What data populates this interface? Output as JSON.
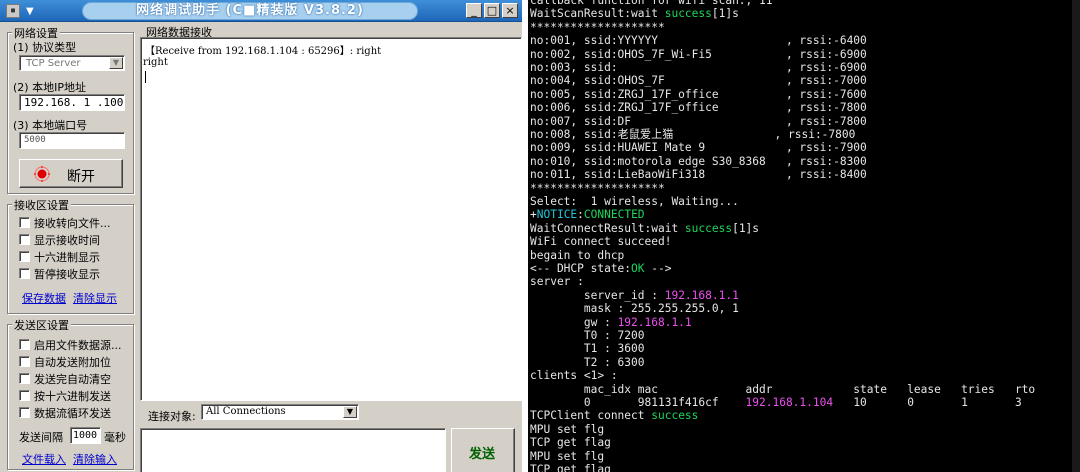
{
  "window": {
    "title": "网络调试助手 (C■精装版 V3.8.2)",
    "sys_icon": "▪",
    "sys_arrow": "▼",
    "controls": {
      "minimize": "_",
      "maximize": "□",
      "close": "×"
    }
  },
  "network_settings": {
    "title": "网络设置",
    "protocol_label": "(1) 协议类型",
    "protocol_value": "TCP Server",
    "ip_label": "(2) 本地IP地址",
    "ip_value": "192.168. 1 .100",
    "port_label": "(3) 本地端口号",
    "port_value": "5000",
    "disconnect_label": "断开"
  },
  "receive_settings": {
    "title": "接收区设置",
    "options": [
      "接收转向文件...",
      "显示接收时间",
      "十六进制显示",
      "暂停接收显示"
    ],
    "save_link": "保存数据",
    "clear_link": "清除显示"
  },
  "send_settings": {
    "title": "发送区设置",
    "options": [
      "启用文件数据源...",
      "自动发送附加位",
      "发送完自动清空",
      "按十六进制发送",
      "数据流循环发送"
    ],
    "interval_label": "发送间隔",
    "interval_value": "1000",
    "interval_unit": "毫秒",
    "load_file_link": "文件载入",
    "clear_input_link": "清除输入"
  },
  "receive_area": {
    "title": "网络数据接收",
    "lines": [
      "【Receive from 192.168.1.104 : 65296】: right",
      "right"
    ]
  },
  "connect_target": {
    "label": "连接对象:",
    "value": "All Connections"
  },
  "send_button": "发送",
  "terminal": {
    "lines": [
      [
        [
          "",
          "callback function for wifi scan:, 11"
        ]
      ],
      [
        [
          "",
          "WaitScanResult:wait "
        ],
        [
          "g",
          "success"
        ],
        [
          "",
          "[1]s"
        ]
      ],
      [
        [
          "",
          "********************"
        ]
      ],
      [
        [
          "",
          "no:001, ssid:YYYYYY                   , rssi:-6400"
        ]
      ],
      [
        [
          "",
          "no:002, ssid:OHOS_7F_Wi-Fi5           , rssi:-6900"
        ]
      ],
      [
        [
          "",
          "no:003, ssid:                         , rssi:-6900"
        ]
      ],
      [
        [
          "",
          "no:004, ssid:OHOS_7F                  , rssi:-7000"
        ]
      ],
      [
        [
          "",
          "no:005, ssid:ZRGJ_17F_office          , rssi:-7600"
        ]
      ],
      [
        [
          "",
          "no:006, ssid:ZRGJ_17F_office          , rssi:-7800"
        ]
      ],
      [
        [
          "",
          "no:007, ssid:DF                       , rssi:-7800"
        ]
      ],
      [
        [
          "",
          "no:008, ssid:老鼠爱上猫               , rssi:-7800"
        ]
      ],
      [
        [
          "",
          "no:009, ssid:HUAWEI Mate 9            , rssi:-7900"
        ]
      ],
      [
        [
          "",
          "no:010, ssid:motorola edge S30_8368   , rssi:-8300"
        ]
      ],
      [
        [
          "",
          "no:011, ssid:LieBaoWiFi318            , rssi:-8400"
        ]
      ],
      [
        [
          "",
          "********************"
        ]
      ],
      [
        [
          "",
          "Select:  1 wireless, Waiting..."
        ]
      ],
      [
        [
          "",
          "+"
        ],
        [
          "c",
          "NOTICE"
        ],
        [
          "",
          ":"
        ],
        [
          "g",
          "CONNECTED"
        ]
      ],
      [
        [
          "",
          "WaitConnectResult:wait "
        ],
        [
          "g",
          "success"
        ],
        [
          "",
          "[1]s"
        ]
      ],
      [
        [
          "",
          "WiFi connect succeed!"
        ]
      ],
      [
        [
          "",
          "begain to dhcp"
        ]
      ],
      [
        [
          "",
          "<-- DHCP state:"
        ],
        [
          "g",
          "OK"
        ],
        [
          "",
          " -->"
        ]
      ],
      [
        [
          "",
          "server :"
        ]
      ],
      [
        [
          "",
          "        server_id : "
        ],
        [
          "m",
          "192.168.1.1"
        ]
      ],
      [
        [
          "",
          "        mask : 255.255.255.0, 1"
        ]
      ],
      [
        [
          "",
          "        gw : "
        ],
        [
          "m",
          "192.168.1.1"
        ]
      ],
      [
        [
          "",
          "        T0 : 7200"
        ]
      ],
      [
        [
          "",
          "        T1 : 3600"
        ]
      ],
      [
        [
          "",
          "        T2 : 6300"
        ]
      ],
      [
        [
          "",
          "clients <1> :"
        ]
      ],
      [
        [
          "",
          "        mac_idx mac             addr            state   lease   tries   rto"
        ]
      ],
      [
        [
          "",
          "        0       981131f416cf    "
        ],
        [
          "m",
          "192.168.1.104"
        ],
        [
          "",
          "   10      0       1       3"
        ]
      ],
      [
        [
          "",
          "TCPClient connect "
        ],
        [
          "g",
          "success"
        ]
      ],
      [
        [
          "",
          "MPU set flg"
        ]
      ],
      [
        [
          "",
          "TCP get flag"
        ]
      ],
      [
        [
          "",
          "MPU set flg"
        ]
      ],
      [
        [
          "",
          "TCP get flag"
        ]
      ]
    ]
  }
}
